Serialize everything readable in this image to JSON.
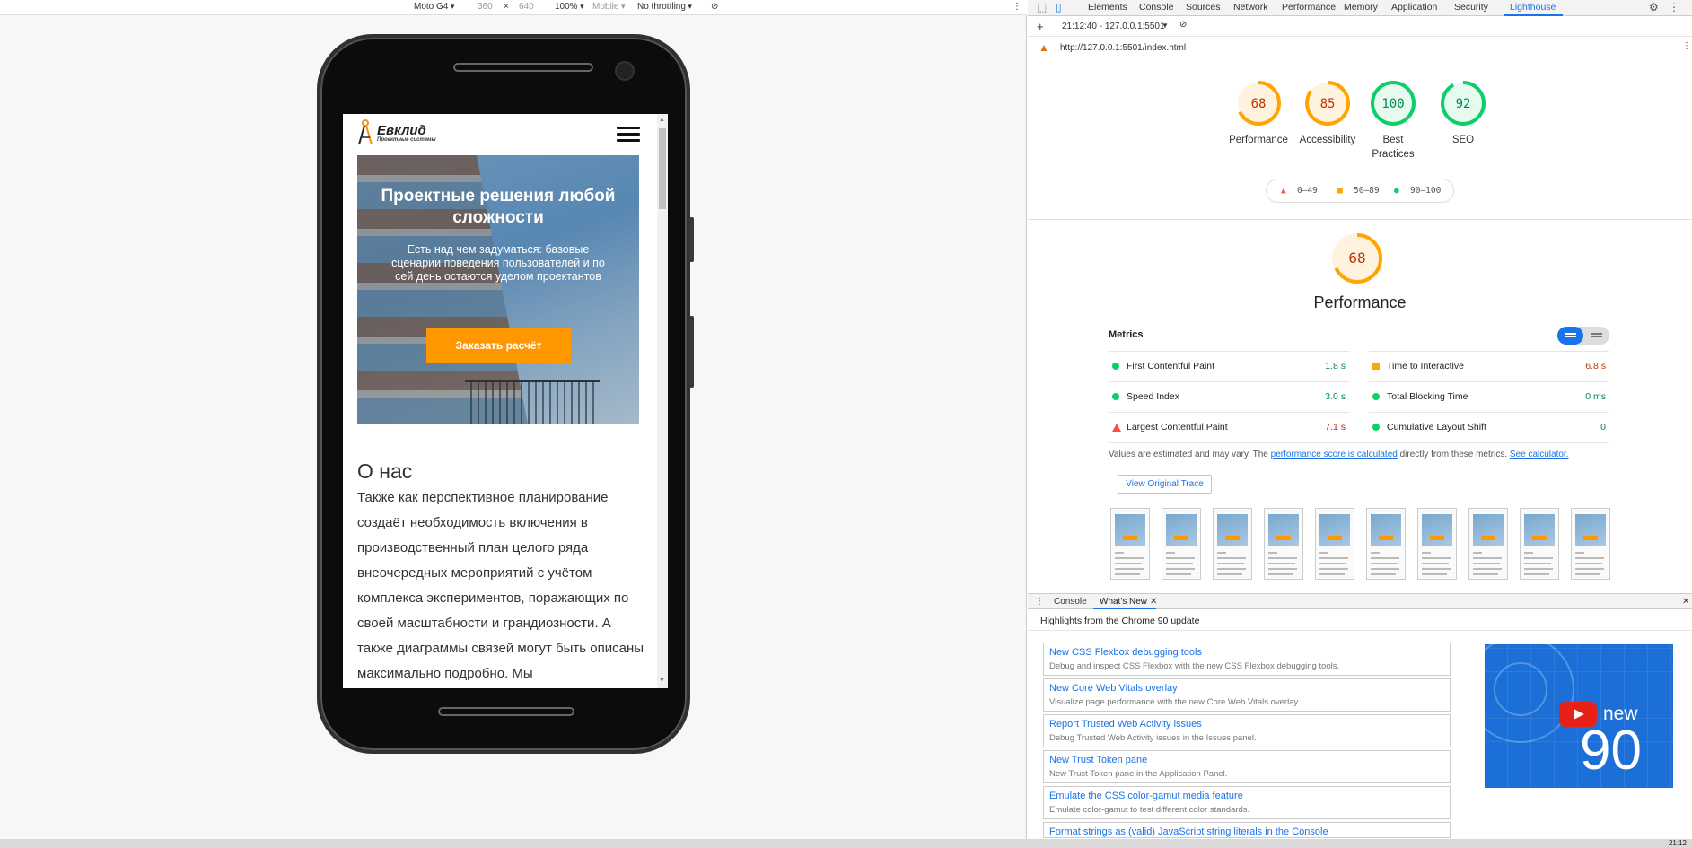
{
  "device_toolbar": {
    "device": "Moto G4",
    "width": "360",
    "times": "×",
    "height": "640",
    "zoom": "100%",
    "mode": "Mobile",
    "throttling": "No throttling"
  },
  "site": {
    "logo_name": "Евклид",
    "logo_sub": "Проектные системы",
    "hero_title": "Проектные решения любой сложности",
    "hero_text": "Есть над чем задуматься: базовые сценарии поведения пользователей и по сей день остаются уделом проектантов",
    "hero_button": "Заказать расчёт",
    "about_title": "О нас",
    "about_text": "Также как перспективное планирование создаёт необходимость включения в производственный план целого ряда внеочередных мероприятий с учётом комплекса экспериментов, поражающих по своей масштабности и грандиозности. А также диаграммы связей могут быть описаны максимально подробно. Мы"
  },
  "devtools": {
    "tabs": [
      "Elements",
      "Console",
      "Sources",
      "Network",
      "Performance",
      "Memory",
      "Application",
      "Security",
      "Lighthouse"
    ],
    "active_tab": "Lighthouse",
    "report_select": "21:12:40 - 127.0.0.1:5501",
    "url": "http://127.0.0.1:5501/index.html",
    "scores": [
      {
        "label": "Performance",
        "value": "68",
        "color": "#ffa400"
      },
      {
        "label": "Accessibility",
        "value": "85",
        "color": "#ffa400"
      },
      {
        "label": "Best Practices",
        "value": "100",
        "color": "#0cce6b"
      },
      {
        "label": "SEO",
        "value": "92",
        "color": "#0cce6b"
      }
    ],
    "legend": {
      "bad": "0–49",
      "average": "50–89",
      "good": "90–100"
    },
    "perf_score": "68",
    "perf_title": "Performance",
    "metrics_label": "Metrics",
    "metrics": [
      {
        "name": "First Contentful Paint",
        "value": "1.8 s",
        "status": "good"
      },
      {
        "name": "Time to Interactive",
        "value": "6.8 s",
        "status": "average"
      },
      {
        "name": "Speed Index",
        "value": "3.0 s",
        "status": "good"
      },
      {
        "name": "Total Blocking Time",
        "value": "0 ms",
        "status": "good"
      },
      {
        "name": "Largest Contentful Paint",
        "value": "7.1 s",
        "status": "bad"
      },
      {
        "name": "Cumulative Layout Shift",
        "value": "0",
        "status": "good"
      }
    ],
    "note_prefix": "Values are estimated and may vary. The ",
    "note_link1": "performance score is calculated",
    "note_middle": " directly from these metrics. ",
    "note_link2": "See calculator.",
    "view_trace": "View Original Trace",
    "colors": {
      "good": "#0cce6b",
      "average": "#ffa400",
      "bad": "#ff4e42",
      "accent": "#1a73e8"
    }
  },
  "drawer": {
    "tabs": [
      "Console",
      "What's New"
    ],
    "highlights": "Highlights from the Chrome 90 update",
    "items": [
      {
        "title": "New CSS Flexbox debugging tools",
        "desc": "Debug and inspect CSS Flexbox with the new CSS Flexbox debugging tools."
      },
      {
        "title": "New Core Web Vitals overlay",
        "desc": "Visualize page performance with the new Core Web Vitals overlay."
      },
      {
        "title": "Report Trusted Web Activity issues",
        "desc": "Debug Trusted Web Activity issues in the Issues panel."
      },
      {
        "title": "New Trust Token pane",
        "desc": "New Trust Token pane in the Application Panel."
      },
      {
        "title": "Emulate the CSS color-gamut media feature",
        "desc": "Emulate color-gamut to test different color standards."
      },
      {
        "title": "Format strings as (valid) JavaScript string literals in the Console",
        "desc": ""
      }
    ],
    "video_new": "new",
    "video_num": "90"
  },
  "taskbar": {
    "clock": "21:12"
  }
}
